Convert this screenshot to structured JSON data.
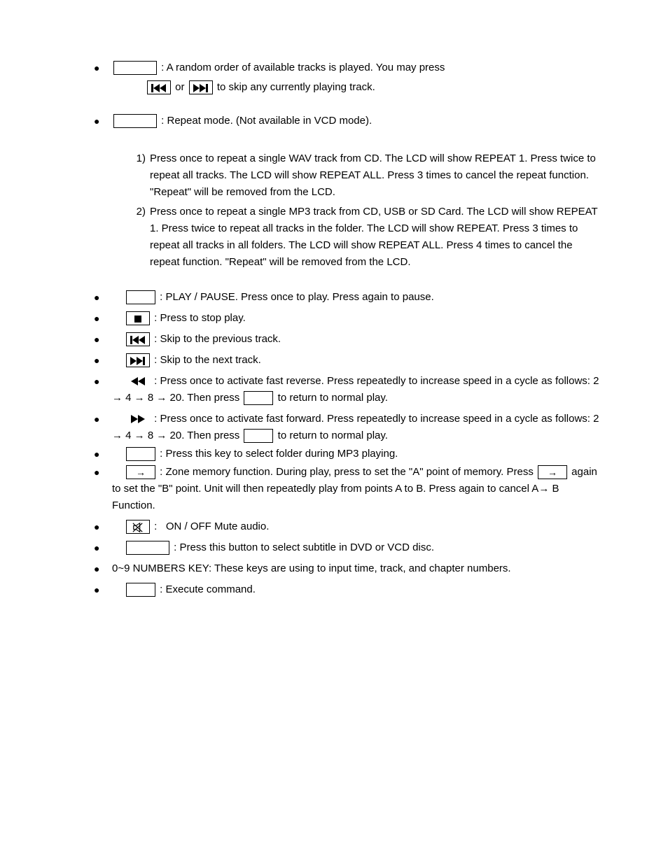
{
  "items": {
    "random": {
      "text1": ": A random order of available tracks is played. You may press",
      "text_or": "or",
      "text2": "to skip any currently playing track."
    },
    "repeat": {
      "text": ": Repeat mode. (Not available in VCD mode).",
      "n1": "1)",
      "n1text": "Press once to repeat a single WAV track from CD. The LCD will show REPEAT 1. Press twice to repeat all tracks. The LCD will show REPEAT ALL. Press 3 times to cancel the repeat function. \"Repeat\" will be removed from the LCD.",
      "n2": "2)",
      "n2text": "Press once to repeat a single MP3 track from CD, USB or SD Card. The LCD will show REPEAT 1. Press twice to repeat all tracks in the folder. The LCD will show REPEAT. Press 3 times to repeat all tracks in all folders. The LCD will show REPEAT ALL. Press 4 times to cancel the repeat function. \"Repeat\" will be removed from the LCD."
    },
    "play": ": PLAY / PAUSE. Press once to play. Press again to pause.",
    "stop": ": Press to stop play.",
    "prev": ": Skip to the previous track.",
    "next": ": Skip to the next track.",
    "rew": {
      "a": ": Press once to activate fast reverse. Press repeatedly to increase speed in a cycle as follows: 2 → 4 → 8 → 20. Then press",
      "b": "to return to normal play."
    },
    "ff": {
      "a": ": Press once to activate fast forward. Press repeatedly to increase speed in a cycle as follows: 2 → 4 → 8 → 20. Then press",
      "b": "to return to normal play."
    },
    "folder": ": Press this key to select folder during MP3 playing.",
    "zone": {
      "arrow": "→",
      "a": ": Zone memory function. During play, press to set the \"A\" point of memory. Press",
      "b": "again to set the \"B\" point. Unit will then repeatedly play from points A to B. Press again to cancel A→ B Function."
    },
    "mute": ":   ON / OFF Mute audio.",
    "subtitle": ": Press this button to select subtitle in DVD or VCD disc.",
    "numbers": "0~9 NUMBERS KEY: These keys are using to input time, track, and chapter numbers.",
    "enter": ": Execute command."
  }
}
